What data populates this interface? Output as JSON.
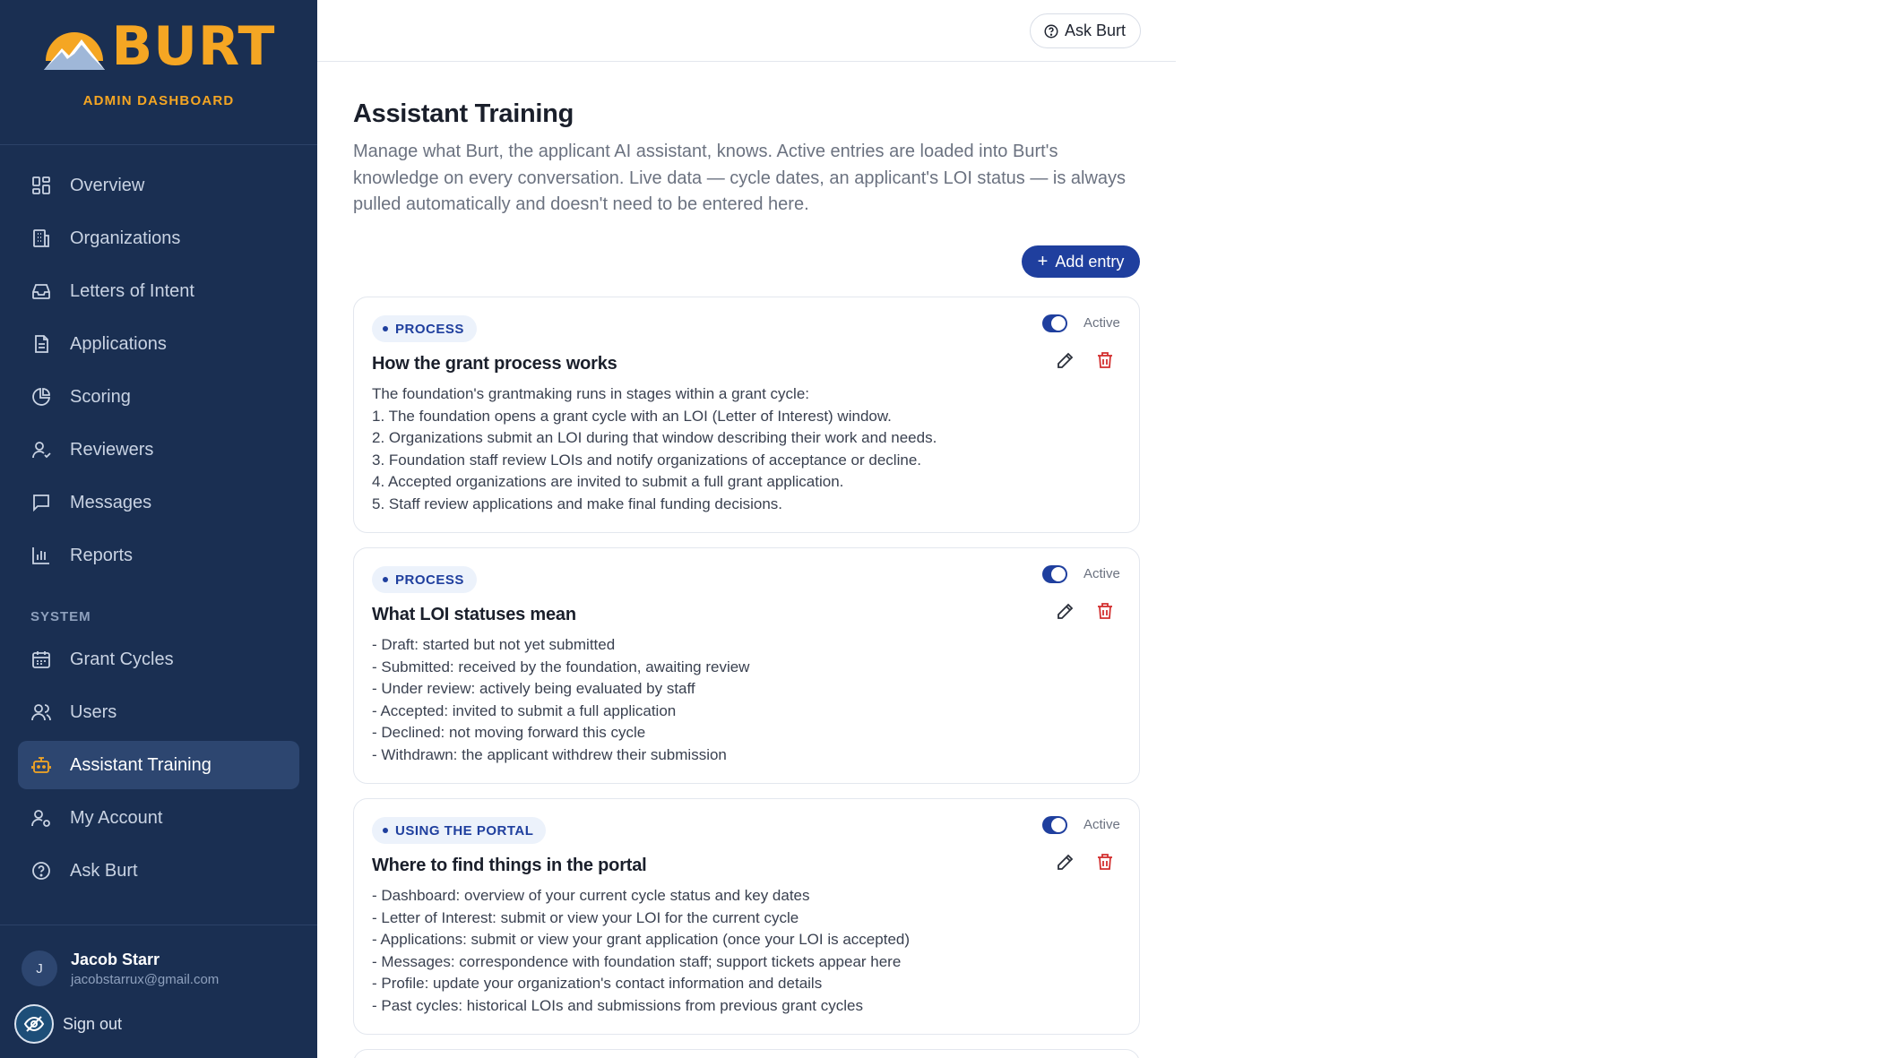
{
  "brand": {
    "name": "BURT",
    "subtitle": "ADMIN DASHBOARD",
    "accent_color": "#f5a623",
    "sidebar_bg": "#1a2f52"
  },
  "nav": {
    "items": [
      {
        "label": "Overview",
        "icon": "grid-icon"
      },
      {
        "label": "Organizations",
        "icon": "building-icon"
      },
      {
        "label": "Letters of Intent",
        "icon": "inbox-icon"
      },
      {
        "label": "Applications",
        "icon": "document-icon"
      },
      {
        "label": "Scoring",
        "icon": "pie-chart-icon"
      },
      {
        "label": "Reviewers",
        "icon": "user-check-icon"
      },
      {
        "label": "Messages",
        "icon": "message-icon"
      },
      {
        "label": "Reports",
        "icon": "bar-chart-icon"
      }
    ],
    "system_section_label": "SYSTEM",
    "system_items": [
      {
        "label": "Grant Cycles",
        "icon": "calendar-icon"
      },
      {
        "label": "Users",
        "icon": "users-icon"
      },
      {
        "label": "Assistant Training",
        "icon": "bot-icon",
        "active": true
      },
      {
        "label": "My Account",
        "icon": "user-cog-icon"
      },
      {
        "label": "Ask Burt",
        "icon": "help-circle-icon"
      }
    ]
  },
  "user": {
    "initial": "J",
    "name": "Jacob Starr",
    "email": "jacobstarrux@gmail.com",
    "signout_label": "Sign out"
  },
  "topbar": {
    "ask_label": "Ask Burt"
  },
  "page": {
    "title": "Assistant Training",
    "description": "Manage what Burt, the applicant AI assistant, knows. Active entries are loaded into Burt's knowledge on every conversation. Live data — cycle dates, an applicant's LOI status — is always pulled automatically and doesn't need to be entered here.",
    "add_label": "Add entry"
  },
  "entries": [
    {
      "category": "PROCESS",
      "status": "Active",
      "active": true,
      "title": "How the grant process works",
      "lines": [
        "The foundation's grantmaking runs in stages within a grant cycle:",
        "1. The foundation opens a grant cycle with an LOI (Letter of Interest) window.",
        "2. Organizations submit an LOI during that window describing their work and needs.",
        "3. Foundation staff review LOIs and notify organizations of acceptance or decline.",
        "4. Accepted organizations are invited to submit a full grant application.",
        "5. Staff review applications and make final funding decisions."
      ]
    },
    {
      "category": "PROCESS",
      "status": "Active",
      "active": true,
      "title": "What LOI statuses mean",
      "lines": [
        "- Draft: started but not yet submitted",
        "- Submitted: received by the foundation, awaiting review",
        "- Under review: actively being evaluated by staff",
        "- Accepted: invited to submit a full application",
        "- Declined: not moving forward this cycle",
        "- Withdrawn: the applicant withdrew their submission"
      ]
    },
    {
      "category": "USING THE PORTAL",
      "status": "Active",
      "active": true,
      "title": "Where to find things in the portal",
      "lines": [
        "- Dashboard: overview of your current cycle status and key dates",
        "- Letter of Interest: submit or view your LOI for the current cycle",
        "- Applications: submit or view your grant application (once your LOI is accepted)",
        "- Messages: correspondence with foundation staff; support tickets appear here",
        "- Profile: update your organization's contact information and details",
        "- Past cycles: historical LOIs and submissions from previous grant cycles"
      ]
    }
  ]
}
